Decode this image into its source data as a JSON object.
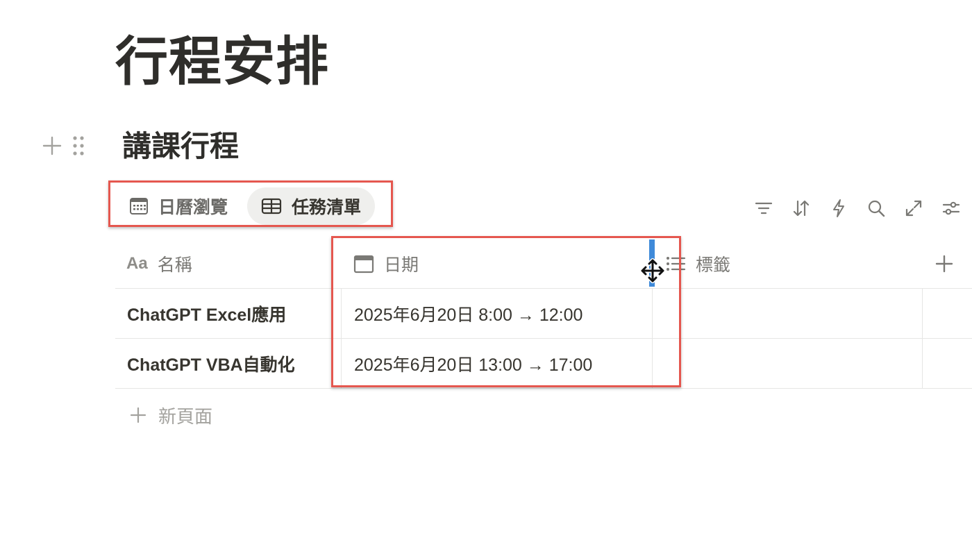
{
  "page": {
    "title": "行程安排"
  },
  "database": {
    "title": "講課行程",
    "tabs": [
      {
        "label": "日曆瀏覽",
        "icon": "calendar-view-icon",
        "active": false
      },
      {
        "label": "任務清單",
        "icon": "table-view-icon",
        "active": true
      }
    ],
    "toolbar": [
      "filter-icon",
      "sort-icon",
      "automation-icon",
      "search-icon",
      "expand-icon",
      "settings-icon"
    ],
    "columns": [
      {
        "label": "名稱",
        "icon": "text-property-icon"
      },
      {
        "label": "日期",
        "icon": "date-property-icon"
      },
      {
        "label": "標籤",
        "icon": "multiselect-property-icon"
      }
    ],
    "rows": [
      {
        "name": "ChatGPT Excel應用",
        "date": "2025年6月20日 8:00 → 12:00",
        "tags": ""
      },
      {
        "name": "ChatGPT VBA自動化",
        "date": "2025年6月20日 13:00 → 17:00",
        "tags": ""
      }
    ],
    "new_page_label": "新頁面",
    "text_icon_glyph": "Aa"
  },
  "colors": {
    "highlight": "#e5574f",
    "resize_indicator": "#3f8ad9"
  }
}
